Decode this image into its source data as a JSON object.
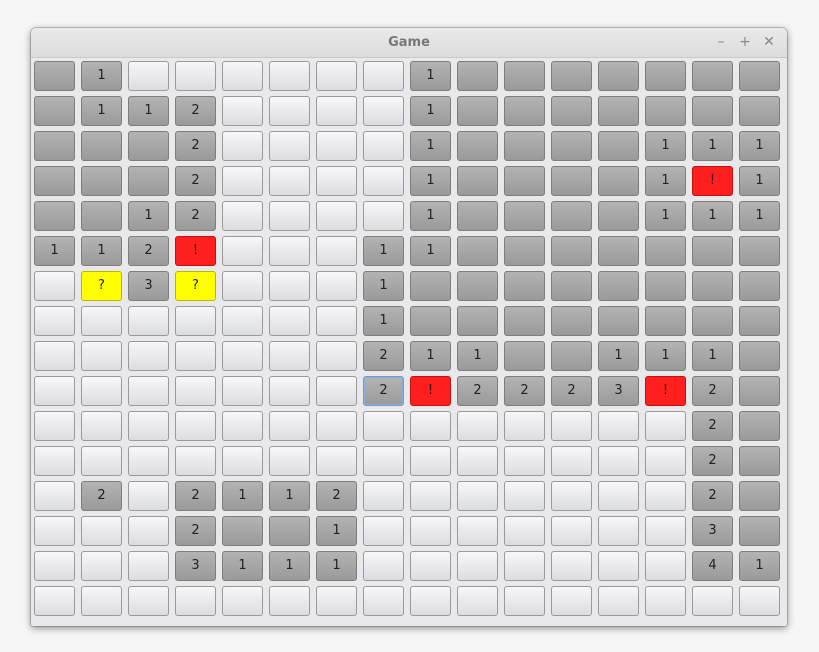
{
  "window": {
    "title": "Game",
    "controls": {
      "minimize": "–",
      "maximize": "+",
      "close": "✕"
    }
  },
  "board": {
    "cols": 16,
    "rows": 16,
    "legend": {
      "c": "covered",
      "r": "revealed",
      "f": "flag",
      "q": "question"
    },
    "selected": [
      9,
      7
    ],
    "grid": [
      [
        [
          "r",
          ""
        ],
        [
          "r",
          "1"
        ],
        [
          "c",
          ""
        ],
        [
          "c",
          ""
        ],
        [
          "c",
          ""
        ],
        [
          "c",
          ""
        ],
        [
          "c",
          ""
        ],
        [
          "c",
          ""
        ],
        [
          "r",
          "1"
        ],
        [
          "r",
          ""
        ],
        [
          "r",
          ""
        ],
        [
          "r",
          ""
        ],
        [
          "r",
          ""
        ],
        [
          "r",
          ""
        ],
        [
          "r",
          ""
        ],
        [
          "r",
          ""
        ]
      ],
      [
        [
          "r",
          ""
        ],
        [
          "r",
          "1"
        ],
        [
          "r",
          "1"
        ],
        [
          "r",
          "2"
        ],
        [
          "c",
          ""
        ],
        [
          "c",
          ""
        ],
        [
          "c",
          ""
        ],
        [
          "c",
          ""
        ],
        [
          "r",
          "1"
        ],
        [
          "r",
          ""
        ],
        [
          "r",
          ""
        ],
        [
          "r",
          ""
        ],
        [
          "r",
          ""
        ],
        [
          "r",
          ""
        ],
        [
          "r",
          ""
        ],
        [
          "r",
          ""
        ]
      ],
      [
        [
          "r",
          ""
        ],
        [
          "r",
          ""
        ],
        [
          "r",
          ""
        ],
        [
          "r",
          "2"
        ],
        [
          "c",
          ""
        ],
        [
          "c",
          ""
        ],
        [
          "c",
          ""
        ],
        [
          "c",
          ""
        ],
        [
          "r",
          "1"
        ],
        [
          "r",
          ""
        ],
        [
          "r",
          ""
        ],
        [
          "r",
          ""
        ],
        [
          "r",
          ""
        ],
        [
          "r",
          "1"
        ],
        [
          "r",
          "1"
        ],
        [
          "r",
          "1"
        ]
      ],
      [
        [
          "r",
          ""
        ],
        [
          "r",
          ""
        ],
        [
          "r",
          ""
        ],
        [
          "r",
          "2"
        ],
        [
          "c",
          ""
        ],
        [
          "c",
          ""
        ],
        [
          "c",
          ""
        ],
        [
          "c",
          ""
        ],
        [
          "r",
          "1"
        ],
        [
          "r",
          ""
        ],
        [
          "r",
          ""
        ],
        [
          "r",
          ""
        ],
        [
          "r",
          ""
        ],
        [
          "r",
          "1"
        ],
        [
          "f",
          "!"
        ],
        [
          "r",
          "1"
        ]
      ],
      [
        [
          "r",
          ""
        ],
        [
          "r",
          ""
        ],
        [
          "r",
          "1"
        ],
        [
          "r",
          "2"
        ],
        [
          "c",
          ""
        ],
        [
          "c",
          ""
        ],
        [
          "c",
          ""
        ],
        [
          "c",
          ""
        ],
        [
          "r",
          "1"
        ],
        [
          "r",
          ""
        ],
        [
          "r",
          ""
        ],
        [
          "r",
          ""
        ],
        [
          "r",
          ""
        ],
        [
          "r",
          "1"
        ],
        [
          "r",
          "1"
        ],
        [
          "r",
          "1"
        ]
      ],
      [
        [
          "r",
          "1"
        ],
        [
          "r",
          "1"
        ],
        [
          "r",
          "2"
        ],
        [
          "f",
          "!"
        ],
        [
          "c",
          ""
        ],
        [
          "c",
          ""
        ],
        [
          "c",
          ""
        ],
        [
          "r",
          "1"
        ],
        [
          "r",
          "1"
        ],
        [
          "r",
          ""
        ],
        [
          "r",
          ""
        ],
        [
          "r",
          ""
        ],
        [
          "r",
          ""
        ],
        [
          "r",
          ""
        ],
        [
          "r",
          ""
        ],
        [
          "r",
          ""
        ]
      ],
      [
        [
          "c",
          ""
        ],
        [
          "q",
          "?"
        ],
        [
          "r",
          "3"
        ],
        [
          "q",
          "?"
        ],
        [
          "c",
          ""
        ],
        [
          "c",
          ""
        ],
        [
          "c",
          ""
        ],
        [
          "r",
          "1"
        ],
        [
          "r",
          ""
        ],
        [
          "r",
          ""
        ],
        [
          "r",
          ""
        ],
        [
          "r",
          ""
        ],
        [
          "r",
          ""
        ],
        [
          "r",
          ""
        ],
        [
          "r",
          ""
        ],
        [
          "r",
          ""
        ]
      ],
      [
        [
          "c",
          ""
        ],
        [
          "c",
          ""
        ],
        [
          "c",
          ""
        ],
        [
          "c",
          ""
        ],
        [
          "c",
          ""
        ],
        [
          "c",
          ""
        ],
        [
          "c",
          ""
        ],
        [
          "r",
          "1"
        ],
        [
          "r",
          ""
        ],
        [
          "r",
          ""
        ],
        [
          "r",
          ""
        ],
        [
          "r",
          ""
        ],
        [
          "r",
          ""
        ],
        [
          "r",
          ""
        ],
        [
          "r",
          ""
        ],
        [
          "r",
          ""
        ]
      ],
      [
        [
          "c",
          ""
        ],
        [
          "c",
          ""
        ],
        [
          "c",
          ""
        ],
        [
          "c",
          ""
        ],
        [
          "c",
          ""
        ],
        [
          "c",
          ""
        ],
        [
          "c",
          ""
        ],
        [
          "r",
          "2"
        ],
        [
          "r",
          "1"
        ],
        [
          "r",
          "1"
        ],
        [
          "r",
          ""
        ],
        [
          "r",
          ""
        ],
        [
          "r",
          "1"
        ],
        [
          "r",
          "1"
        ],
        [
          "r",
          "1"
        ],
        [
          "r",
          ""
        ]
      ],
      [
        [
          "c",
          ""
        ],
        [
          "c",
          ""
        ],
        [
          "c",
          ""
        ],
        [
          "c",
          ""
        ],
        [
          "c",
          ""
        ],
        [
          "c",
          ""
        ],
        [
          "c",
          ""
        ],
        [
          "r",
          "2"
        ],
        [
          "f",
          "!"
        ],
        [
          "r",
          "2"
        ],
        [
          "r",
          "2"
        ],
        [
          "r",
          "2"
        ],
        [
          "r",
          "3"
        ],
        [
          "f",
          "!"
        ],
        [
          "r",
          "2"
        ],
        [
          "r",
          ""
        ]
      ],
      [
        [
          "c",
          ""
        ],
        [
          "c",
          ""
        ],
        [
          "c",
          ""
        ],
        [
          "c",
          ""
        ],
        [
          "c",
          ""
        ],
        [
          "c",
          ""
        ],
        [
          "c",
          ""
        ],
        [
          "c",
          ""
        ],
        [
          "c",
          ""
        ],
        [
          "c",
          ""
        ],
        [
          "c",
          ""
        ],
        [
          "c",
          ""
        ],
        [
          "c",
          ""
        ],
        [
          "c",
          ""
        ],
        [
          "r",
          "2"
        ],
        [
          "r",
          ""
        ]
      ],
      [
        [
          "c",
          ""
        ],
        [
          "c",
          ""
        ],
        [
          "c",
          ""
        ],
        [
          "c",
          ""
        ],
        [
          "c",
          ""
        ],
        [
          "c",
          ""
        ],
        [
          "c",
          ""
        ],
        [
          "c",
          ""
        ],
        [
          "c",
          ""
        ],
        [
          "c",
          ""
        ],
        [
          "c",
          ""
        ],
        [
          "c",
          ""
        ],
        [
          "c",
          ""
        ],
        [
          "c",
          ""
        ],
        [
          "r",
          "2"
        ],
        [
          "r",
          ""
        ]
      ],
      [
        [
          "c",
          ""
        ],
        [
          "r",
          "2"
        ],
        [
          "c",
          ""
        ],
        [
          "r",
          "2"
        ],
        [
          "r",
          "1"
        ],
        [
          "r",
          "1"
        ],
        [
          "r",
          "2"
        ],
        [
          "c",
          ""
        ],
        [
          "c",
          ""
        ],
        [
          "c",
          ""
        ],
        [
          "c",
          ""
        ],
        [
          "c",
          ""
        ],
        [
          "c",
          ""
        ],
        [
          "c",
          ""
        ],
        [
          "r",
          "2"
        ],
        [
          "r",
          ""
        ]
      ],
      [
        [
          "c",
          ""
        ],
        [
          "c",
          ""
        ],
        [
          "c",
          ""
        ],
        [
          "r",
          "2"
        ],
        [
          "r",
          ""
        ],
        [
          "r",
          ""
        ],
        [
          "r",
          "1"
        ],
        [
          "c",
          ""
        ],
        [
          "c",
          ""
        ],
        [
          "c",
          ""
        ],
        [
          "c",
          ""
        ],
        [
          "c",
          ""
        ],
        [
          "c",
          ""
        ],
        [
          "c",
          ""
        ],
        [
          "r",
          "3"
        ],
        [
          "r",
          ""
        ]
      ],
      [
        [
          "c",
          ""
        ],
        [
          "c",
          ""
        ],
        [
          "c",
          ""
        ],
        [
          "r",
          "3"
        ],
        [
          "r",
          "1"
        ],
        [
          "r",
          "1"
        ],
        [
          "r",
          "1"
        ],
        [
          "c",
          ""
        ],
        [
          "c",
          ""
        ],
        [
          "c",
          ""
        ],
        [
          "c",
          ""
        ],
        [
          "c",
          ""
        ],
        [
          "c",
          ""
        ],
        [
          "c",
          ""
        ],
        [
          "r",
          "4"
        ],
        [
          "r",
          "1"
        ]
      ],
      [
        [
          "c",
          ""
        ],
        [
          "c",
          ""
        ],
        [
          "c",
          ""
        ],
        [
          "c",
          ""
        ],
        [
          "c",
          ""
        ],
        [
          "c",
          ""
        ],
        [
          "c",
          ""
        ],
        [
          "c",
          ""
        ],
        [
          "c",
          ""
        ],
        [
          "c",
          ""
        ],
        [
          "c",
          ""
        ],
        [
          "c",
          ""
        ],
        [
          "c",
          ""
        ],
        [
          "c",
          ""
        ],
        [
          "c",
          ""
        ],
        [
          "c",
          ""
        ]
      ]
    ]
  }
}
